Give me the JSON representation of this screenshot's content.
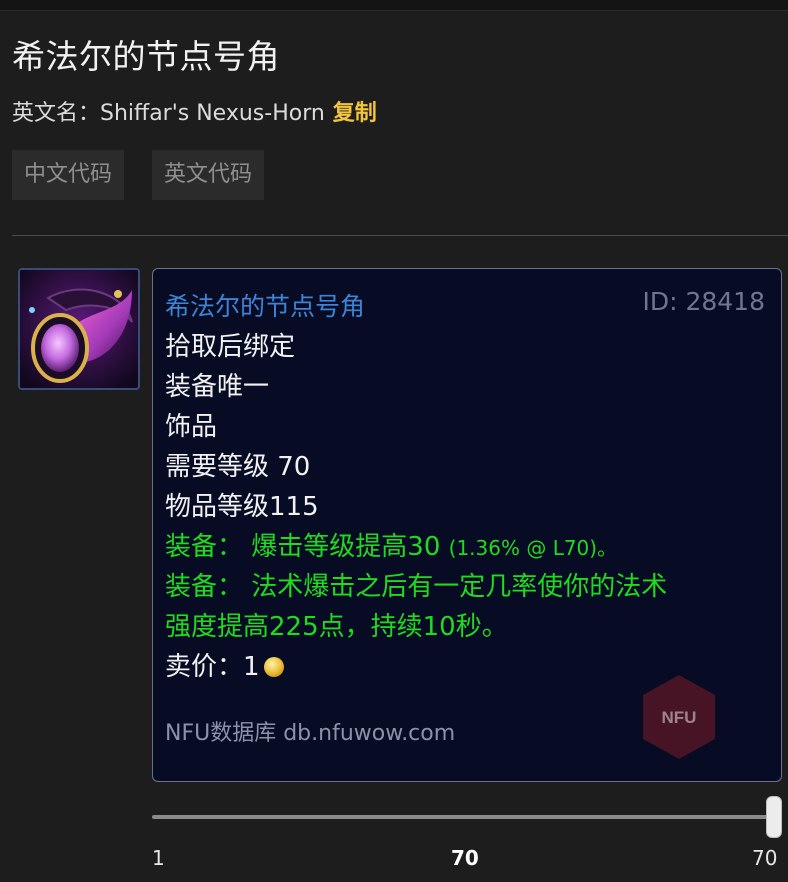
{
  "page": {
    "title": "希法尔的节点号角",
    "english_name_label": "英文名：",
    "english_name": "Shiffar's Nexus-Horn",
    "copy_label": "复制",
    "buttons": {
      "chinese_code": "中文代码",
      "english_code": "英文代码"
    }
  },
  "tooltip": {
    "name": "希法尔的节点号角",
    "id_text": "ID: 28418",
    "bind": "拾取后绑定",
    "unique": "装备唯一",
    "slot": "饰品",
    "req_level": "需要等级 70",
    "item_level": "物品等级115",
    "equip1_label": "装备：",
    "equip1_text": "爆击等级提高30",
    "equip1_note": "(1.36% @ L70)。",
    "equip2_label": "装备：",
    "equip2_text_line1": "法术爆击之后有一定几率使你的法术",
    "equip2_text_line2": "强度提高225点，持续10秒。",
    "sell_label": "卖价：",
    "sell_value": "1",
    "site": "NFU数据库 db.nfuwow.com",
    "watermark": "NFU"
  },
  "level_slider": {
    "min": "1",
    "value": "70",
    "max": "70",
    "fraction": 1.0
  },
  "colors": {
    "accent_gold": "#f2c53d",
    "item_name_blue": "#3d83d6",
    "equip_green": "#1fdb1f",
    "tooltip_bg": "#070c24"
  },
  "icons": {
    "item": "horn-trinket-icon",
    "coin": "gold-coin-icon"
  }
}
